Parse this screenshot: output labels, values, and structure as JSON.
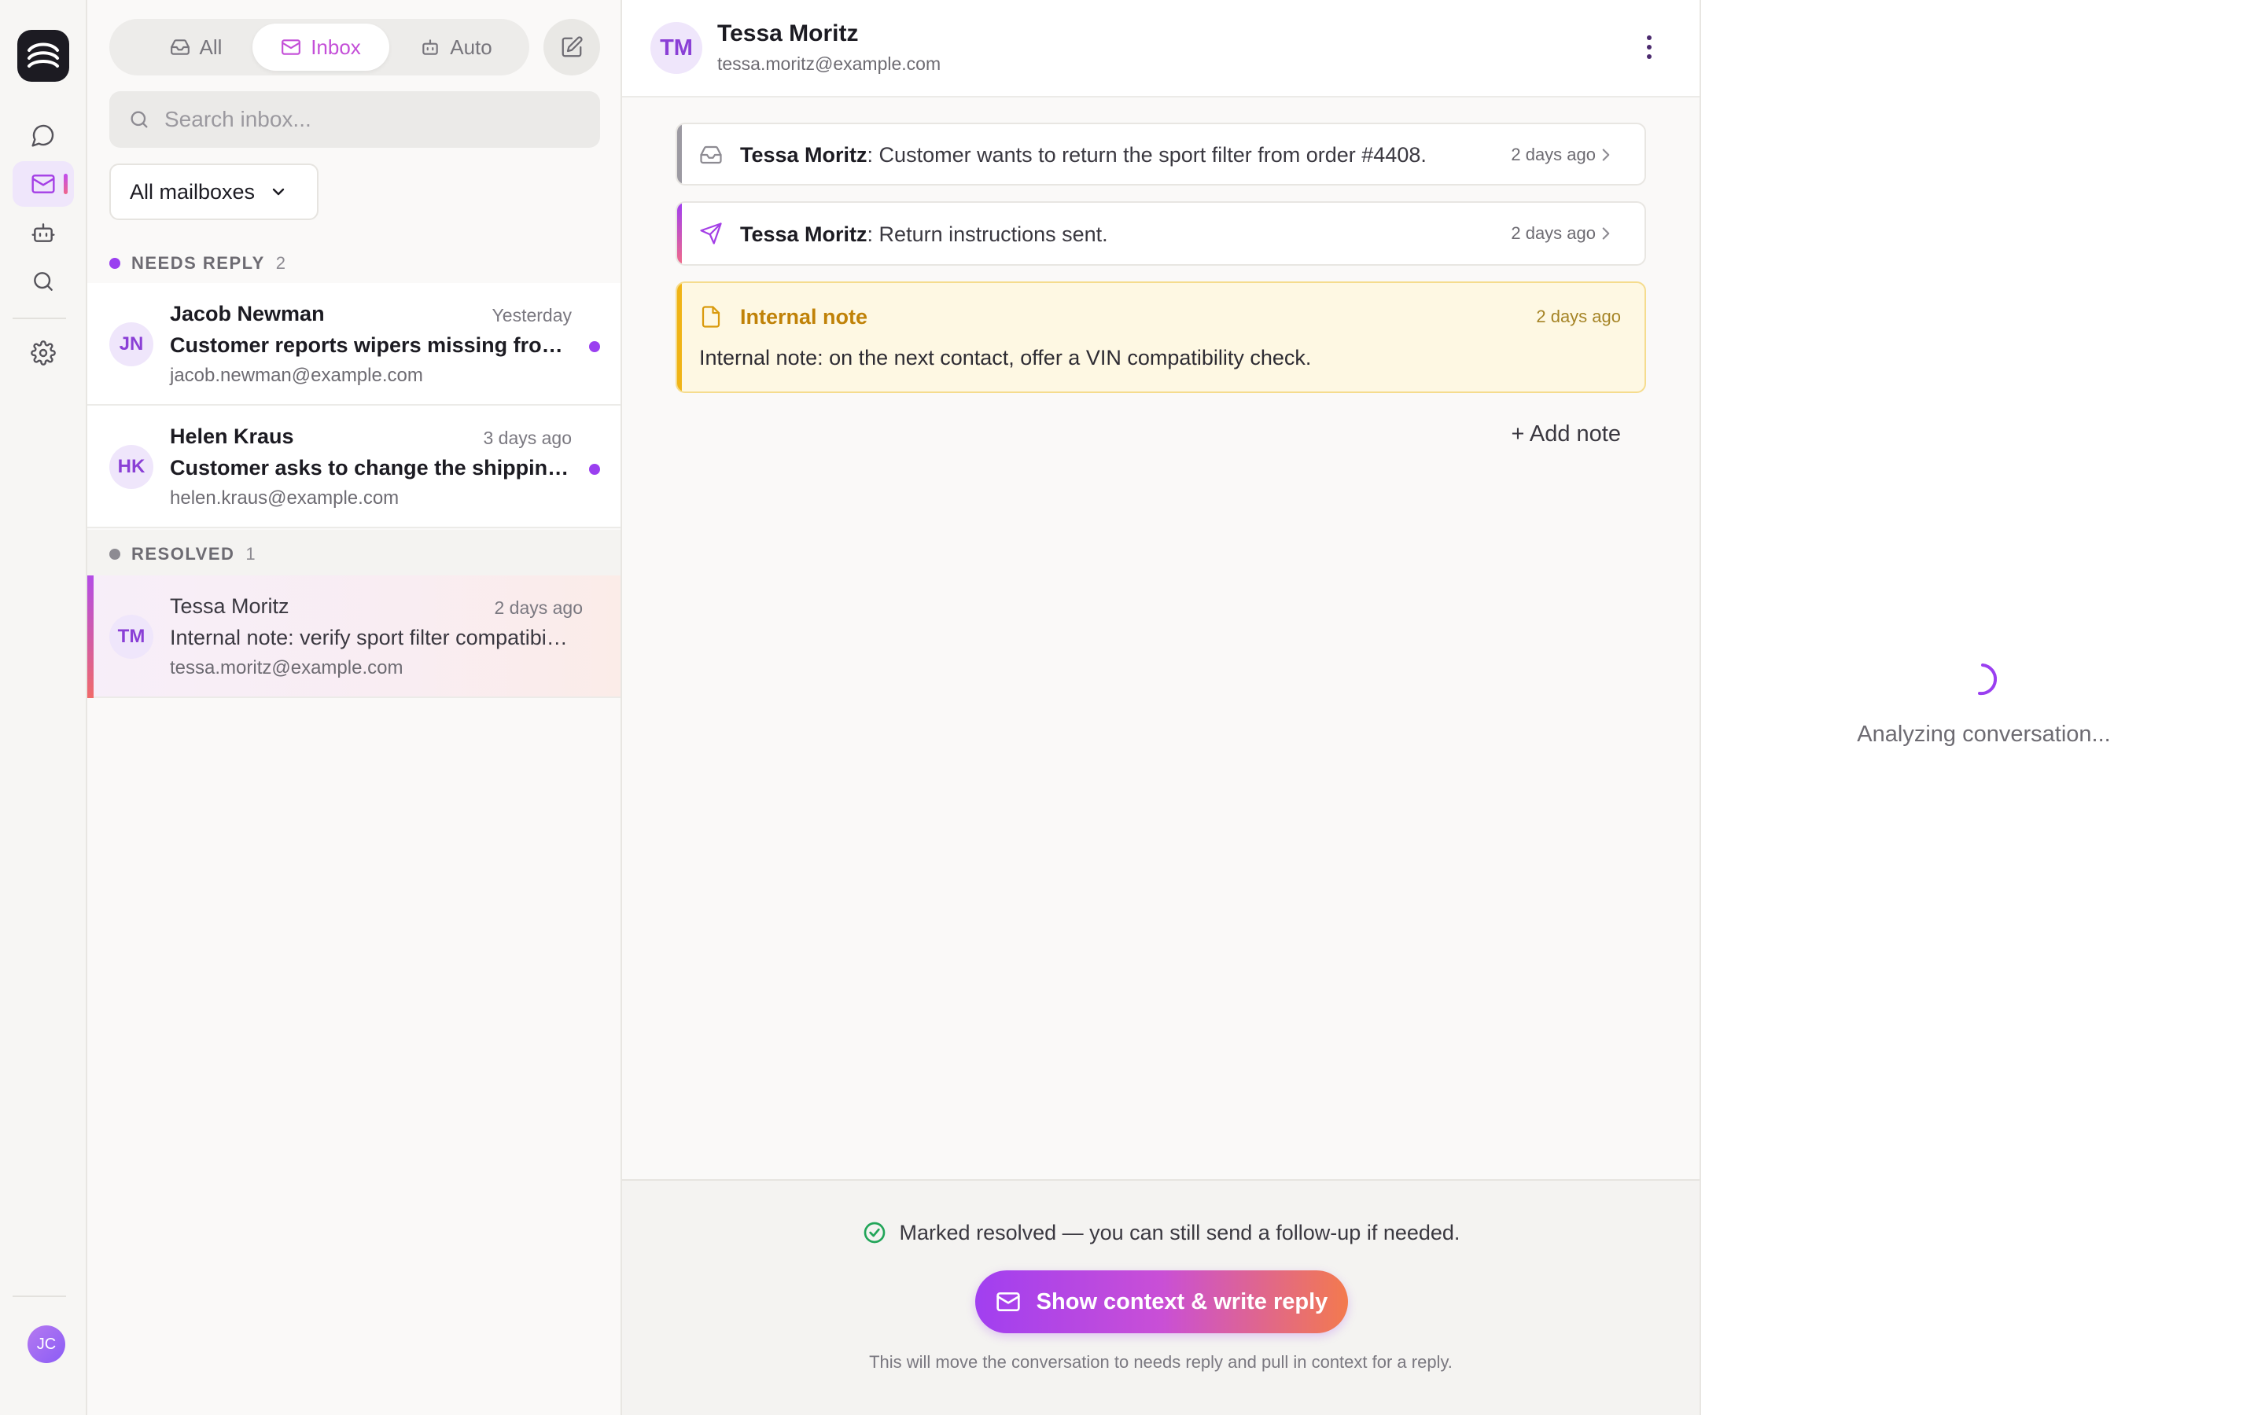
{
  "rail": {
    "logo": "wave-logo",
    "items": [
      "chat-icon",
      "mail-icon",
      "bot-icon",
      "search-icon",
      "gear-icon"
    ],
    "active": "mail-icon",
    "user_initials": "JC"
  },
  "tabs": [
    {
      "label": "All",
      "icon": "tray-icon"
    },
    {
      "label": "Inbox",
      "icon": "mail-icon",
      "active": true
    },
    {
      "label": "Auto",
      "icon": "bot-icon"
    }
  ],
  "search": {
    "placeholder": "Search inbox..."
  },
  "mailbox_filter": {
    "value": "All mailboxes"
  },
  "sections": {
    "needs_reply": {
      "label": "NEEDS REPLY",
      "count": "2",
      "color": "#9a3ff0"
    },
    "resolved": {
      "label": "RESOLVED",
      "count": "1",
      "color": "#8d8b92"
    }
  },
  "conversations": [
    {
      "initials": "JN",
      "name": "Jacob Newman",
      "time": "Yesterday",
      "subject": "Customer reports wipers missing from order",
      "email": "jacob.newman@example.com",
      "unread": true
    },
    {
      "initials": "HK",
      "name": "Helen Kraus",
      "time": "3 days ago",
      "subject": "Customer asks to change the shipping address",
      "email": "helen.kraus@example.com",
      "unread": true
    },
    {
      "initials": "TM",
      "name": "Tessa Moritz",
      "time": "2 days ago",
      "subject": "Internal note: verify sport filter compatibility",
      "email": "tessa.moritz@example.com",
      "selected": true
    }
  ],
  "thread": {
    "contact": {
      "initials": "TM",
      "name": "Tessa Moritz",
      "email": "tessa.moritz@example.com"
    },
    "messages": [
      {
        "kind": "inbound",
        "icon": "tray-icon",
        "author": "Tessa Moritz",
        "text": ": Customer wants to return the sport filter from order #4408.",
        "time": "2 days ago",
        "bar_color": "#9c9aa2"
      },
      {
        "kind": "outbound",
        "icon": "send-icon",
        "author": "Tessa Moritz",
        "text": ": Return instructions sent.",
        "time": "2 days ago",
        "bar_color": "#b34ce6"
      }
    ],
    "note": {
      "title": "Internal note",
      "time": "2 days ago",
      "body": "Internal note: on the next contact, offer a VIN compatibility check."
    },
    "add_note_label": "+ Add note",
    "footer": {
      "status": "Marked resolved — you can still send a follow-up if needed.",
      "cta_label": "Show context & write reply",
      "hint": "This will move the conversation to needs reply and pull in context for a reply."
    }
  },
  "side_panel": {
    "status": "Analyzing conversation..."
  }
}
